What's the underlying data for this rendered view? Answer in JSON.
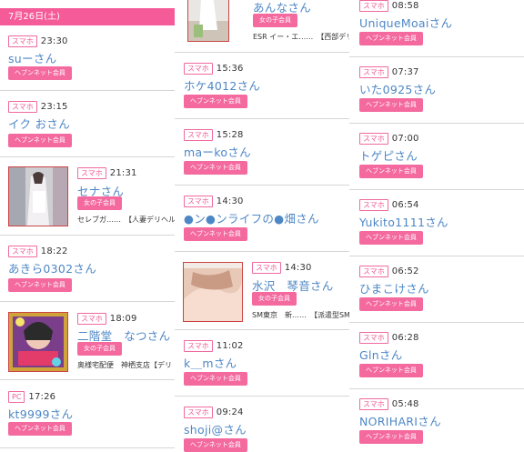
{
  "date_header": "7月26日(土)",
  "col1": [
    {
      "device": "スマホ",
      "time": "23:30",
      "name": "suーさん",
      "badge": "ヘブンネット会員"
    },
    {
      "device": "スマホ",
      "time": "23:15",
      "name": "イク おさん",
      "badge": "ヘブンネット会員"
    },
    {
      "device": "スマホ",
      "time": "21:31",
      "name": "セナさん",
      "badge": "女の子会員",
      "detail": "セレブガ……　【人妻デリヘル"
    },
    {
      "device": "スマホ",
      "time": "18:22",
      "name": "あきら0302さん",
      "badge": "ヘブンネット会員"
    },
    {
      "device": "スマホ",
      "time": "18:09",
      "name": "二階堂　なつさん",
      "badge": "女の子会員",
      "detail": "奥様宅配便　神栖支店【デリ"
    },
    {
      "device": "PC",
      "time": "17:26",
      "name": "kt9999さん",
      "badge": "ヘブンネット会員"
    }
  ],
  "col2": [
    {
      "name": "あんなさん",
      "badge": "女の子会員",
      "detail": "ESR イー・エ……　【西部デリ"
    },
    {
      "device": "スマホ",
      "time": "15:36",
      "name": "ホケ4012さん",
      "badge": "ヘブンネット会員"
    },
    {
      "device": "スマホ",
      "time": "15:28",
      "name": "maーkoさん",
      "badge": "ヘブンネット会員"
    },
    {
      "device": "スマホ",
      "time": "14:30",
      "name": "●ン●ンライフの●畑さん",
      "badge": "ヘブンネット会員"
    },
    {
      "device": "スマホ",
      "time": "14:30",
      "name": "水沢　琴音さん",
      "badge": "女の子会員",
      "detail": "SM東京　新……　【派遣型SM"
    },
    {
      "device": "スマホ",
      "time": "11:02",
      "name": "k＿mさん",
      "badge": "ヘブンネット会員"
    },
    {
      "device": "スマホ",
      "time": "09:24",
      "name": "shoji@さん",
      "badge": "ヘブンネット会員"
    }
  ],
  "col3": [
    {
      "device": "スマホ",
      "time": "08:58",
      "name": "UniqueMoaiさん",
      "badge": "ヘブンネット会員"
    },
    {
      "device": "スマホ",
      "time": "07:37",
      "name": "いた0925さん",
      "badge": "ヘブンネット会員"
    },
    {
      "device": "スマホ",
      "time": "07:00",
      "name": "トゲピさん",
      "badge": "ヘブンネット会員"
    },
    {
      "device": "スマホ",
      "time": "06:54",
      "name": "Yukito1111さん",
      "badge": "ヘブンネット会員"
    },
    {
      "device": "スマホ",
      "time": "06:52",
      "name": "ひまこけさん",
      "badge": "ヘブンネット会員"
    },
    {
      "device": "スマホ",
      "time": "06:28",
      "name": "Glnさん",
      "badge": "ヘブンネット会員"
    },
    {
      "device": "スマホ",
      "time": "05:48",
      "name": "NORIHARIさん",
      "badge": "ヘブンネット会員"
    }
  ],
  "colors": {
    "accent": "#f46a9f",
    "name_link": "#4e87c6",
    "date_bar": "#f55b99"
  }
}
